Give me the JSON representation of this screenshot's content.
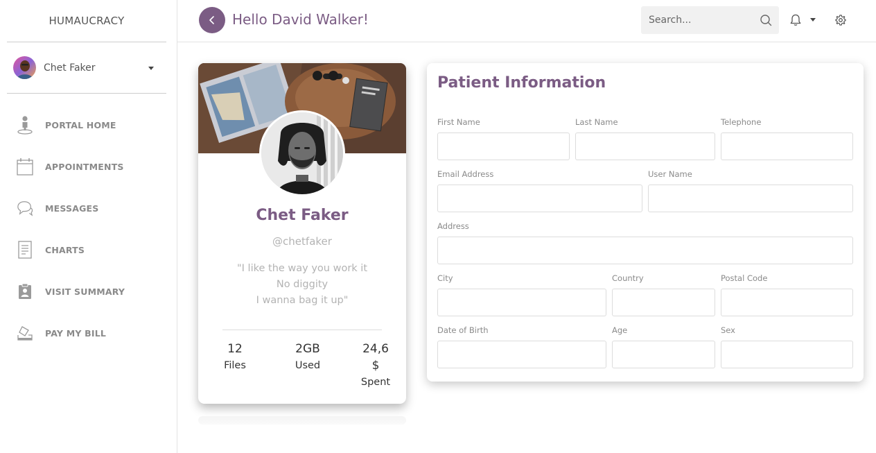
{
  "brand": "HUMAUCRACY",
  "user_menu": {
    "name": "Chet Faker"
  },
  "nav": [
    {
      "label": "PORTAL HOME",
      "icon": "person-pin-icon"
    },
    {
      "label": "APPOINTMENTS",
      "icon": "calendar-icon"
    },
    {
      "label": "MESSAGES",
      "icon": "chat-bubbles-icon"
    },
    {
      "label": "CHARTS",
      "icon": "document-icon"
    },
    {
      "label": "VISIT SUMMARY",
      "icon": "clipboard-badge-icon"
    },
    {
      "label": "PAY MY BILL",
      "icon": "pay-bill-icon"
    }
  ],
  "header": {
    "greeting": "Hello David Walker!",
    "search_placeholder": "Search..."
  },
  "profile": {
    "name": "Chet Faker",
    "handle": "@chetfaker",
    "quote_lines": [
      "\"I like the way you work it",
      "No diggity",
      "I wanna bag it up\""
    ],
    "stats": [
      {
        "value": "12",
        "label": "Files"
      },
      {
        "value": "2GB",
        "label": "Used"
      },
      {
        "value": "24,6 $",
        "label": "Spent"
      }
    ]
  },
  "form": {
    "title": "Patient Information",
    "fields": {
      "first_name": "First Name",
      "last_name": "Last Name",
      "telephone": "Telephone",
      "email": "Email Address",
      "user_name": "User Name",
      "address": "Address",
      "city": "City",
      "country": "Country",
      "postal_code": "Postal Code",
      "dob": "Date of Birth",
      "age": "Age",
      "sex": "Sex"
    }
  },
  "colors": {
    "accent": "#7b5c84",
    "nav_text": "#8a8a8a",
    "muted_text": "#b3b3b3"
  }
}
